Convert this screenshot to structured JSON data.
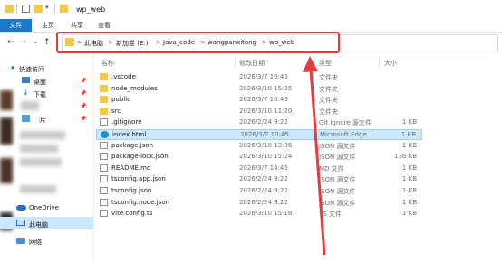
{
  "window": {
    "title": "wp_web"
  },
  "ribbon": {
    "tabs": [
      "文件",
      "主页",
      "共享",
      "查看"
    ]
  },
  "address": {
    "crumbs": [
      "此电脑",
      "新加卷 (E:)",
      "Java_code",
      "wangpanxitong",
      "wp_web"
    ],
    "separator": ">"
  },
  "nav": {
    "back": "←",
    "forward": "→",
    "dropdown": "⌄",
    "up": "↑"
  },
  "sidebar": {
    "quick_access": "快速访问",
    "desktop": "桌面",
    "downloads": "下载",
    "pictures_partial": "图片",
    "onedrive": "OneDrive",
    "this_pc": "此电脑",
    "network": "网络"
  },
  "columns": {
    "name": "名称",
    "modified": "修改日期",
    "type": "类型",
    "size": "大小"
  },
  "files": [
    {
      "name": ".vscode",
      "modified": "2026/3/7 10:45",
      "type": "文件夹",
      "size": "",
      "kind": "folder"
    },
    {
      "name": "node_modules",
      "modified": "2026/3/10 15:25",
      "type": "文件夹",
      "size": "",
      "kind": "folder"
    },
    {
      "name": "public",
      "modified": "2026/3/7 10:45",
      "type": "文件夹",
      "size": "",
      "kind": "folder"
    },
    {
      "name": "src",
      "modified": "2026/3/10 11:20",
      "type": "文件夹",
      "size": "",
      "kind": "folder"
    },
    {
      "name": ".gitignore",
      "modified": "2026/2/24 9:22",
      "type": "Git Ignore 源文件",
      "size": "1 KB",
      "kind": "doc"
    },
    {
      "name": "index.html",
      "modified": "2026/3/7 10:45",
      "type": "Microsoft Edge ...",
      "size": "1 KB",
      "kind": "edge"
    },
    {
      "name": "package.json",
      "modified": "2026/3/10 13:36",
      "type": "JSON 源文件",
      "size": "1 KB",
      "kind": "doc"
    },
    {
      "name": "package-lock.json",
      "modified": "2026/3/10 15:24",
      "type": "JSON 源文件",
      "size": "136 KB",
      "kind": "doc"
    },
    {
      "name": "README.md",
      "modified": "2026/3/7 14:45",
      "type": "MD 文件",
      "size": "1 KB",
      "kind": "doc"
    },
    {
      "name": "tsconfig.app.json",
      "modified": "2026/2/24 9:22",
      "type": "JSON 源文件",
      "size": "1 KB",
      "kind": "doc"
    },
    {
      "name": "tsconfig.json",
      "modified": "2026/2/24 9:22",
      "type": "JSON 源文件",
      "size": "1 KB",
      "kind": "doc"
    },
    {
      "name": "tsconfig.node.json",
      "modified": "2026/2/24 9:22",
      "type": "JSON 源文件",
      "size": "1 KB",
      "kind": "doc"
    },
    {
      "name": "vite.config.ts",
      "modified": "2026/3/10 15:18",
      "type": "TS 文件",
      "size": "1 KB",
      "kind": "doc"
    }
  ],
  "selected_index": 5,
  "colors": {
    "accent": "#1979ca",
    "annotation": "#e8393d",
    "selection": "#cce8ff",
    "folder": "#f2c94c"
  }
}
